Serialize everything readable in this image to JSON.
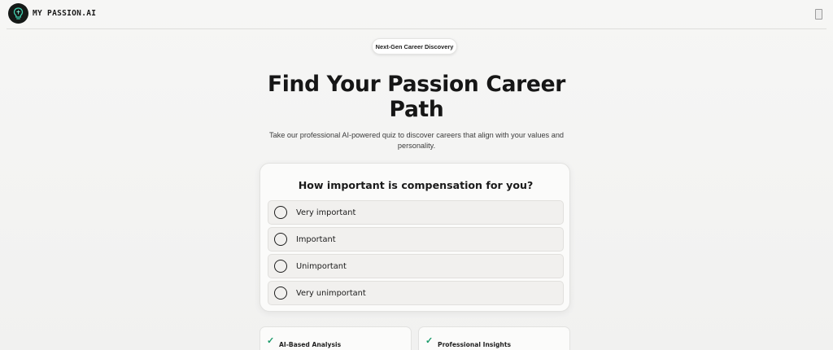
{
  "header": {
    "brand": "MY PASSION.AI",
    "logo_icon": "brain-lightbulb-icon",
    "menu_icon": "menu-icon"
  },
  "hero": {
    "badge": "Next-Gen Career Discovery",
    "title": "Find Your Passion Career Path",
    "subtitle": "Take our professional AI-powered quiz to discover careers that align with your values and personality."
  },
  "quiz": {
    "question": "How important is compensation for you?",
    "options": [
      {
        "label": "Very important"
      },
      {
        "label": "Important"
      },
      {
        "label": "Unimportant"
      },
      {
        "label": "Very unimportant"
      }
    ]
  },
  "features": [
    {
      "label": "AI-Based Analysis",
      "icon": "check-icon"
    },
    {
      "label": "Professional Insights",
      "icon": "check-icon"
    }
  ],
  "colors": {
    "background": "#f3f3f2",
    "accent_check": "#1a9a6a",
    "logo_dark": "#151917",
    "logo_accent": "#3fd1b0"
  }
}
